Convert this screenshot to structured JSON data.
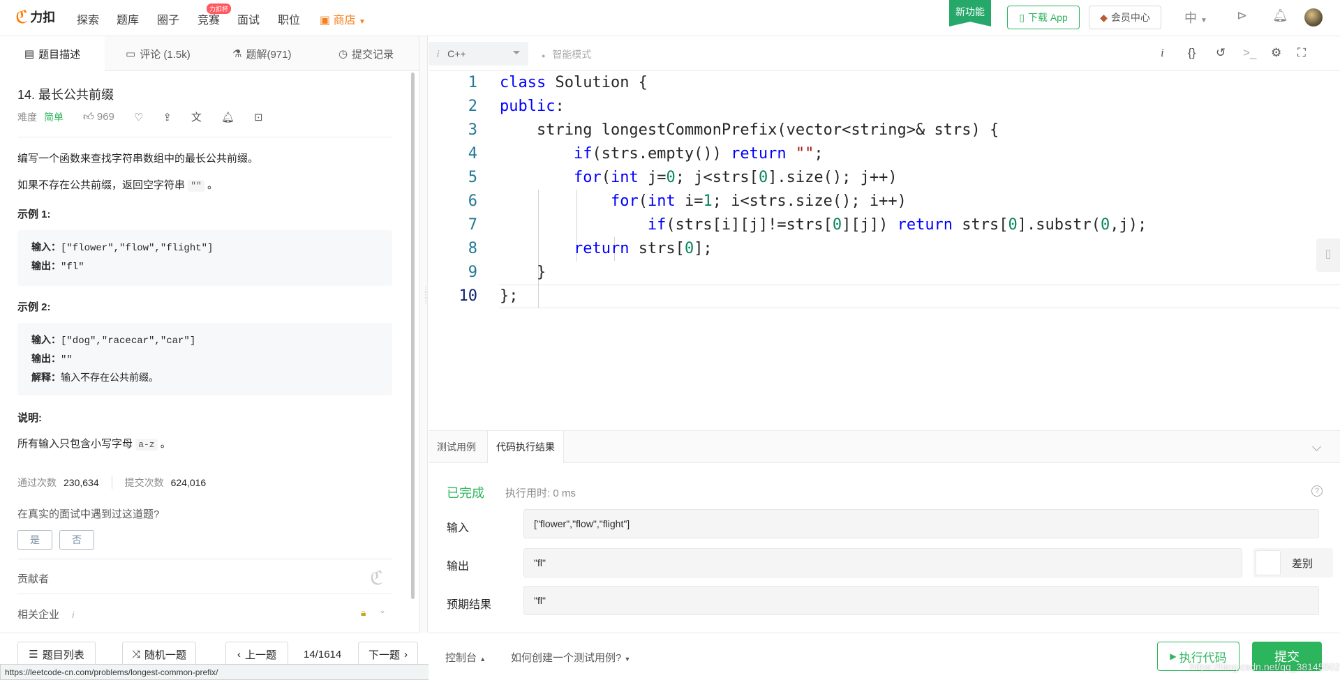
{
  "nav": {
    "logo": "力扣",
    "items": [
      "探索",
      "题库",
      "圈子",
      "竞赛",
      "面试",
      "职位"
    ],
    "contest_badge": "力扣杯",
    "shop": "商店",
    "ribbon": "新功能",
    "download": "下载 App",
    "member": "会员中心",
    "lang": "中"
  },
  "left_tabs": {
    "description": "题目描述",
    "comments": "评论 (1.5k)",
    "solutions": "题解(971)",
    "submissions": "提交记录"
  },
  "problem": {
    "title": "14. 最长公共前缀",
    "difficulty_label": "难度",
    "difficulty": "简单",
    "likes": "969",
    "desc1": "编写一个函数来查找字符串数组中的最长公共前缀。",
    "desc2_prefix": "如果不存在公共前缀，返回空字符串",
    "desc2_code": "\"\"",
    "desc2_suffix": "。",
    "ex1_title": "示例 1:",
    "ex1_in_label": "输入：",
    "ex1_in": "[\"flower\",\"flow\",\"flight\"]",
    "ex1_out_label": "输出：",
    "ex1_out": "\"fl\"",
    "ex2_title": "示例 2:",
    "ex2_in_label": "输入：",
    "ex2_in": "[\"dog\",\"racecar\",\"car\"]",
    "ex2_out_label": "输出：",
    "ex2_out": "\"\"",
    "ex2_exp_label": "解释：",
    "ex2_exp": "输入不存在公共前缀。",
    "note_title": "说明:",
    "note_prefix": "所有输入只包含小写字母",
    "note_code": "a-z",
    "note_suffix": "。",
    "accepted_label": "通过次数",
    "accepted": "230,634",
    "submitted_label": "提交次数",
    "submitted": "624,016",
    "interview_q": "在真实的面试中遇到过这道题?",
    "yes": "是",
    "no": "否",
    "contributors": "贡献者",
    "companies": "相关企业",
    "companies_i": "i"
  },
  "left_bottom": {
    "list": "题目列表",
    "random": "随机一题",
    "prev": "上一题",
    "pager": "14/1614",
    "next": "下一题",
    "url": "https://leetcode-cn.com/problems/longest-common-prefix/"
  },
  "editor": {
    "lang": "C++",
    "smart_mode": "智能模式",
    "line_numbers": [
      "1",
      "2",
      "3",
      "4",
      "5",
      "6",
      "7",
      "8",
      "9",
      "10"
    ]
  },
  "console": {
    "tab_testcase": "测试用例",
    "tab_result": "代码执行结果",
    "status": "已完成",
    "runtime": "执行用时: 0 ms",
    "input_label": "输入",
    "input": "[\"flower\",\"flow\",\"flight\"]",
    "output_label": "输出",
    "output": "\"fl\"",
    "diff": "差别",
    "expected_label": "预期结果",
    "expected": "\"fl\""
  },
  "right_bottom": {
    "console": "控制台",
    "howto": "如何创建一个测试用例?",
    "run": "执行代码",
    "submit": "提交",
    "watermark": "https://blog.csdn.net/qq_38145502"
  },
  "colors": {
    "brand_green": "#2db55d",
    "shop_orange": "#f5811e",
    "keyword_blue": "#0000ff",
    "number_green": "#098658"
  }
}
